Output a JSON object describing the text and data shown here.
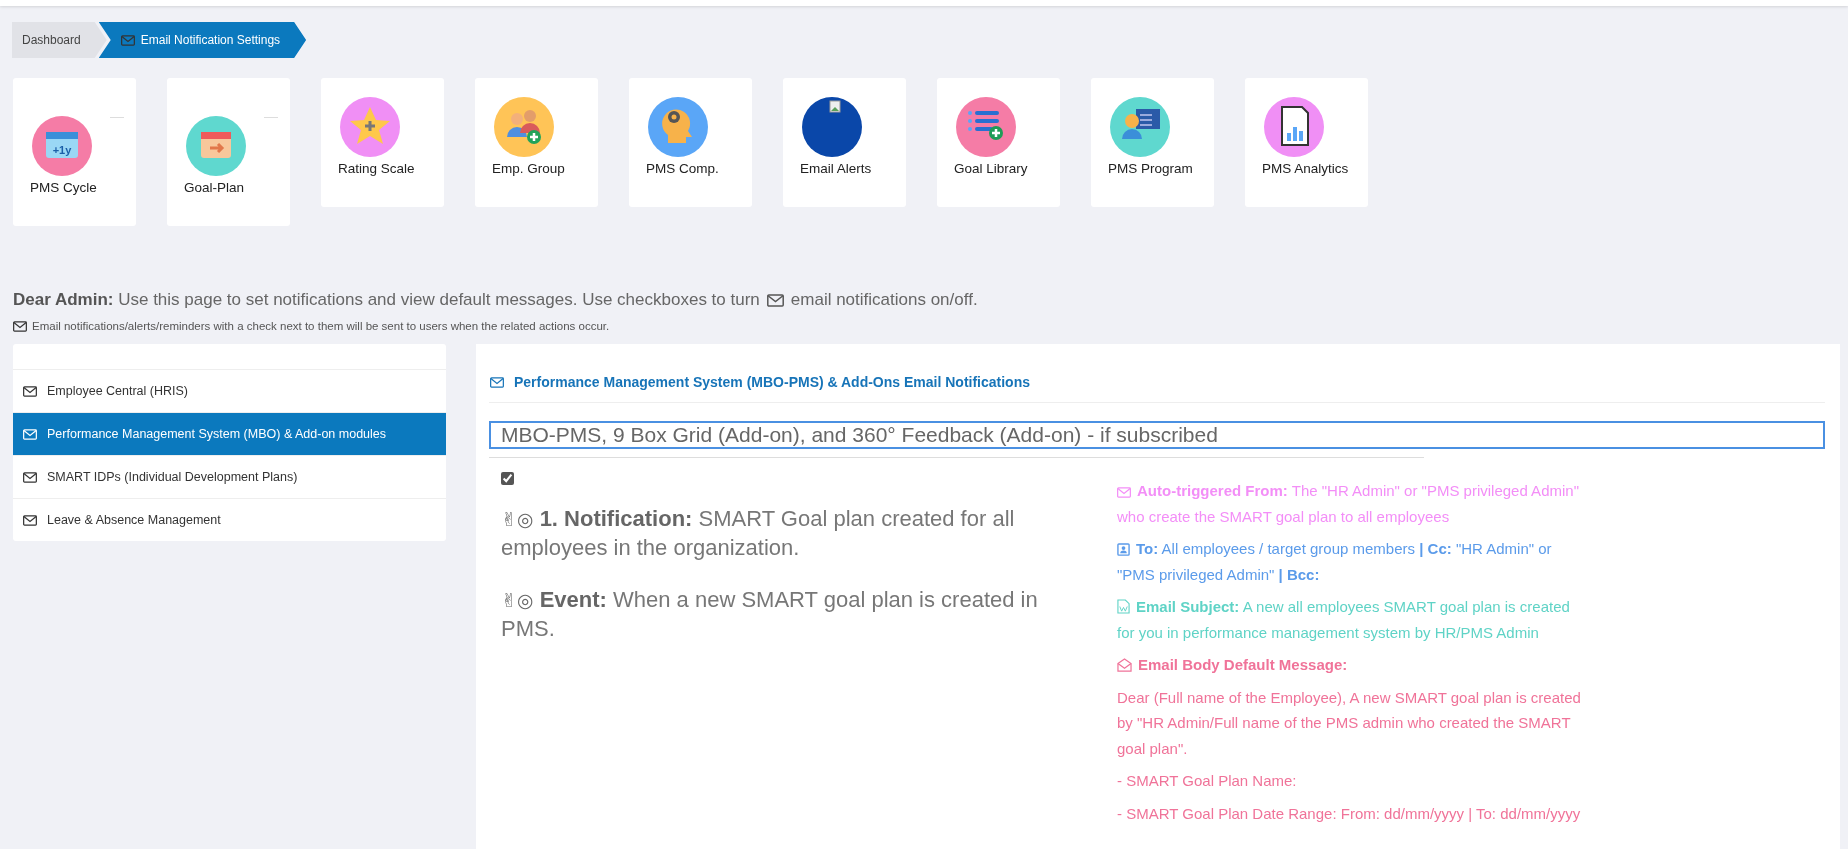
{
  "breadcrumb": [
    {
      "label": "Dashboard",
      "selected": false
    },
    {
      "label": "Email Notification Settings",
      "selected": true
    }
  ],
  "tiles": [
    {
      "label": "PMS Cycle",
      "kind": "cycle",
      "badge": "+1y",
      "color": "#f57ca6"
    },
    {
      "label": "Goal-Plan",
      "kind": "plan",
      "color": "#5fd8cf"
    },
    {
      "label": "Rating Scale",
      "kind": "rating",
      "color": "#f08ff5"
    },
    {
      "label": "Emp. Group",
      "kind": "group",
      "color": "#ffc457"
    },
    {
      "label": "PMS Comp.",
      "kind": "competency",
      "color": "#5aa6f7"
    },
    {
      "label": "Email Alerts",
      "kind": "alerts",
      "color": "#0a47a9"
    },
    {
      "label": "Goal Library",
      "kind": "library",
      "color": "#f57ca6"
    },
    {
      "label": "PMS Program",
      "kind": "program",
      "color": "#5fd8cf"
    },
    {
      "label": "PMS Analytics",
      "kind": "analytics",
      "color": "#f08ff5"
    }
  ],
  "intro": "**Dear Admin:** Use this page to set notifications and view default messages. Use checkboxes to turn",
  "intro_end": "email notifications on/off.",
  "note": "Email notifications/alerts/reminders with a check next to them will be sent to users when the related actions occur.",
  "sidebar": {
    "items": [
      {
        "label": "Employee Central (HRIS)",
        "selected": false
      },
      {
        "label": "Performance Management System (MBO) & Add-on modules",
        "selected": true
      },
      {
        "label": "SMART IDPs (Individual Development Plans)",
        "selected": false
      },
      {
        "label": "Leave & Absence Management",
        "selected": false
      }
    ]
  },
  "panel": {
    "title": "Performance Management System (MBO-PMS) & Add-Ons Email Notifications",
    "section_field": "MBO-PMS, 9 Box Grid (Add-on), and 360° Feedback (Add-on) - if subscribed",
    "checked": true,
    "lines": [
      {
        "prefix": "✌◎",
        "text": "**1. Notification:** SMART Goal plan created for all employees in the organization."
      },
      {
        "prefix": "✌◎",
        "text": "**Event:** When a new SMART goal plan is created in PMS."
      }
    ],
    "details": [
      {
        "kind": "from",
        "color": "#f38ef7",
        "text": "**Auto-triggered From:** The \"HR Admin\" or \"PMS privileged Admin\" who create the SMART goal plan to all employees"
      },
      {
        "kind": "to",
        "color": "#5b9bea",
        "text": "**To:** All employees / target group members   **| Cc:** \"HR Admin\" or \"PMS privileged Admin\"   **| Bcc:**"
      },
      {
        "kind": "subject",
        "color": "#5fd3c6",
        "text": "**Email Subject:** A new all employees SMART goal plan is created for you in performance management system by HR/PMS Admin"
      },
      {
        "kind": "body-heading",
        "color": "#f07399",
        "text": "**Email Body Default Message:**"
      },
      {
        "kind": "paragraph",
        "color": "#f07399",
        "text": "Dear (Full name of the Employee), A new SMART goal plan is created by \"HR Admin/Full name of the PMS admin who created the SMART goal plan\"."
      },
      {
        "kind": "paragraph",
        "color": "#f07399",
        "text": "- SMART Goal Plan Name:"
      },
      {
        "kind": "paragraph",
        "color": "#f07399",
        "text": "- SMART Goal Plan Date Range: From: dd/mm/yyyy | To: dd/mm/yyyy"
      }
    ]
  }
}
